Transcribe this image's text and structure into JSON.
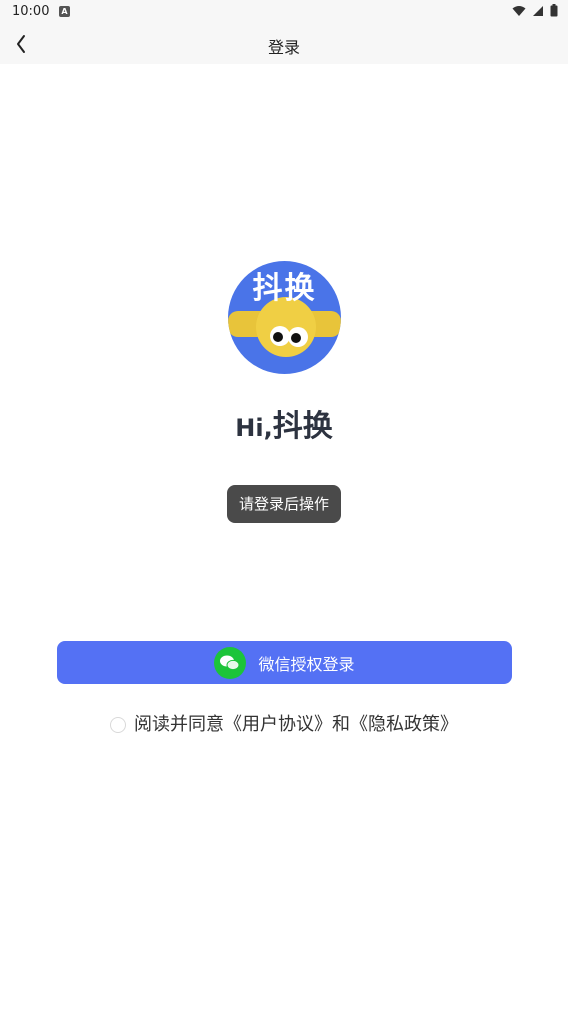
{
  "status_bar": {
    "time": "10:00",
    "icons": [
      "a-icon",
      "wifi-icon",
      "signal-icon",
      "battery-icon"
    ]
  },
  "nav": {
    "title": "登录",
    "back_icon": "chevron-left-icon"
  },
  "logo": {
    "text": "抖换"
  },
  "greeting": {
    "hi": "Hi,",
    "name": "抖换"
  },
  "toast": {
    "text": "请登录后操作"
  },
  "login_button": {
    "label": "微信授权登录",
    "icon": "wechat-icon",
    "bg_color": "#5471f4",
    "icon_color": "#1cc43a"
  },
  "agreement": {
    "prefix": "阅读并同意",
    "user_agreement": "《用户协议》",
    "conjunction": "和",
    "privacy_policy": "《隐私政策》",
    "checked": false
  }
}
